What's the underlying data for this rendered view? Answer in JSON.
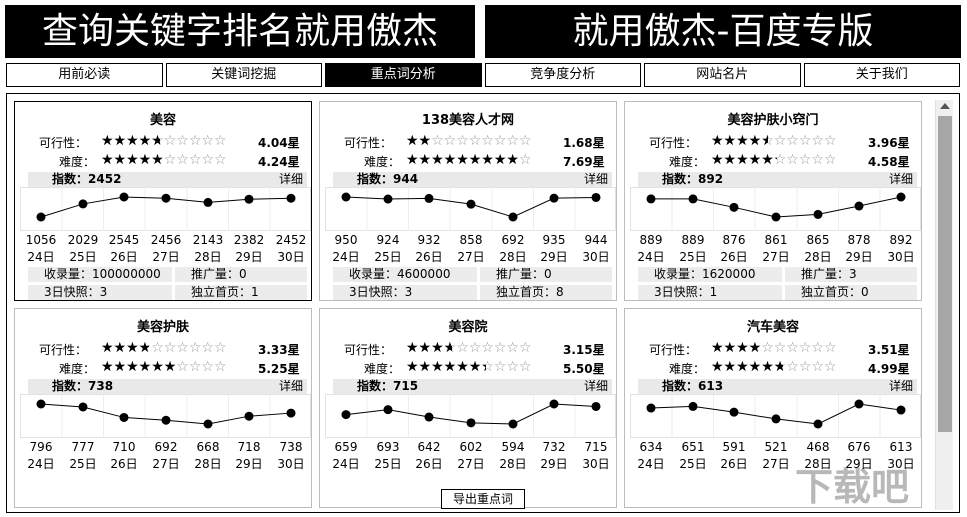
{
  "banner": {
    "left": "查询关键字排名就用傲杰",
    "right": "就用傲杰-百度专版"
  },
  "tabs": [
    {
      "label": "用前必读",
      "active": false
    },
    {
      "label": "关键词挖掘",
      "active": false
    },
    {
      "label": "重点词分析",
      "active": true
    },
    {
      "label": "竞争度分析",
      "active": false
    },
    {
      "label": "网站名片",
      "active": false
    },
    {
      "label": "关于我们",
      "active": false
    }
  ],
  "labels": {
    "feasibility": "可行性：",
    "difficulty": "难度：",
    "index": "指数：",
    "detail": "详细",
    "indexed": "收录量：",
    "promotion": "推广量：",
    "snapshot": "3日快照：",
    "homepage": "独立首页："
  },
  "cards": [
    {
      "title": "美容",
      "feasibility": 4.04,
      "feasibility_text": "4.04星",
      "difficulty": 4.24,
      "difficulty_text": "4.24星",
      "index_value": "2452",
      "values": [
        1056,
        2029,
        2545,
        2456,
        2143,
        2382,
        2452
      ],
      "dates": [
        "24日",
        "25日",
        "26日",
        "27日",
        "28日",
        "29日",
        "30日"
      ],
      "indexed": "100000000",
      "promotion": "0",
      "snapshot": "3",
      "homepage": "1",
      "selected": true
    },
    {
      "title": "138美容人才网",
      "feasibility": 1.68,
      "feasibility_text": "1.68星",
      "difficulty": 7.69,
      "difficulty_text": "7.69星",
      "index_value": "944",
      "values": [
        950,
        924,
        932,
        858,
        692,
        935,
        944
      ],
      "dates": [
        "24日",
        "25日",
        "26日",
        "27日",
        "28日",
        "29日",
        "30日"
      ],
      "indexed": "4600000",
      "promotion": "0",
      "snapshot": "3",
      "homepage": "8",
      "selected": false
    },
    {
      "title": "美容护肤小窍门",
      "feasibility": 3.96,
      "feasibility_text": "3.96星",
      "difficulty": 4.58,
      "difficulty_text": "4.58星",
      "index_value": "892",
      "values": [
        889,
        889,
        876,
        861,
        865,
        878,
        892
      ],
      "dates": [
        "24日",
        "25日",
        "26日",
        "27日",
        "28日",
        "29日",
        "30日"
      ],
      "indexed": "1620000",
      "promotion": "3",
      "snapshot": "1",
      "homepage": "0",
      "selected": false
    },
    {
      "title": "美容护肤",
      "feasibility": 3.33,
      "feasibility_text": "3.33星",
      "difficulty": 5.25,
      "difficulty_text": "5.25星",
      "index_value": "738",
      "values": [
        796,
        777,
        710,
        692,
        668,
        718,
        738
      ],
      "dates": [
        "24日",
        "25日",
        "26日",
        "27日",
        "28日",
        "29日",
        "30日"
      ],
      "selected": false
    },
    {
      "title": "美容院",
      "feasibility": 3.15,
      "feasibility_text": "3.15星",
      "difficulty": 5.5,
      "difficulty_text": "5.50星",
      "index_value": "715",
      "values": [
        659,
        693,
        642,
        602,
        594,
        732,
        715
      ],
      "dates": [
        "24日",
        "25日",
        "26日",
        "27日",
        "28日",
        "29日",
        "30日"
      ],
      "selected": false
    },
    {
      "title": "汽车美容",
      "feasibility": 3.51,
      "feasibility_text": "3.51星",
      "difficulty": 4.99,
      "difficulty_text": "4.99星",
      "index_value": "613",
      "values": [
        634,
        651,
        591,
        521,
        468,
        676,
        613
      ],
      "dates": [
        "24日",
        "25日",
        "26日",
        "27日",
        "28日",
        "29日",
        "30日"
      ],
      "selected": false
    }
  ],
  "export_label": "导出重点词",
  "watermark": "下载吧"
}
